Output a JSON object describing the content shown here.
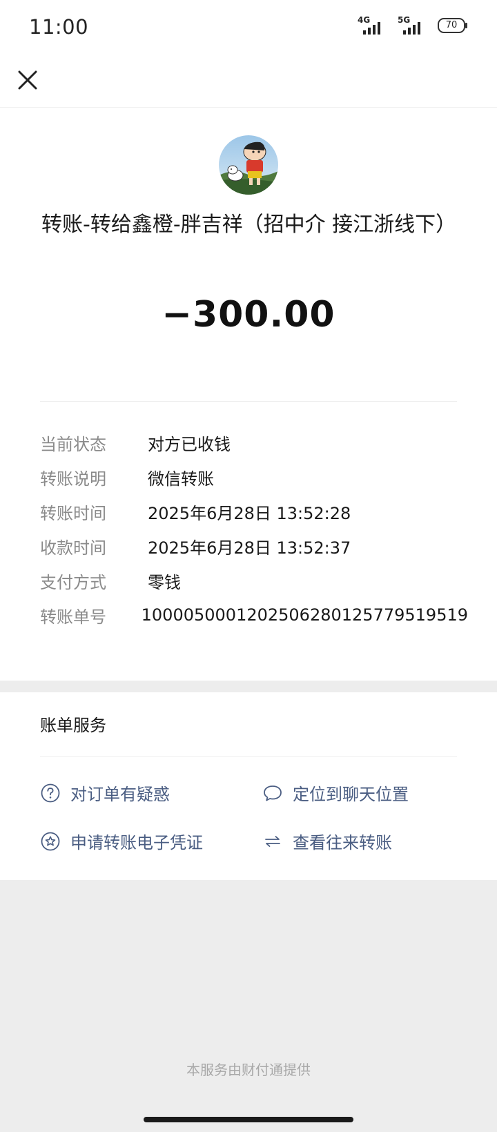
{
  "status_bar": {
    "time": "11:00",
    "network1": "4G",
    "network2": "5G",
    "battery": "70"
  },
  "icons": {
    "close": "close-icon",
    "question": "question-circle-icon",
    "chat": "chat-bubble-icon",
    "star": "star-circle-icon",
    "transfer": "transfer-arrows-icon"
  },
  "header": {
    "title": "转账-转给鑫橙-胖吉祥（招中介 接江浙线下）",
    "amount": "−300.00"
  },
  "details": [
    {
      "label": "当前状态",
      "value": "对方已收钱"
    },
    {
      "label": "转账说明",
      "value": "微信转账"
    },
    {
      "label": "转账时间",
      "value": "2025年6月28日 13:52:28"
    },
    {
      "label": "收款时间",
      "value": "2025年6月28日 13:52:37"
    },
    {
      "label": "支付方式",
      "value": "零钱"
    },
    {
      "label": "转账单号",
      "value": "1000050001202506280125779519519"
    }
  ],
  "services": {
    "title": "账单服务",
    "items": [
      {
        "label": "对订单有疑惑",
        "icon": "question-circle-icon"
      },
      {
        "label": "定位到聊天位置",
        "icon": "chat-bubble-icon"
      },
      {
        "label": "申请转账电子凭证",
        "icon": "star-circle-icon"
      },
      {
        "label": "查看往来转账",
        "icon": "transfer-arrows-icon"
      }
    ]
  },
  "footer": {
    "text": "本服务由财付通提供"
  },
  "colors": {
    "link": "#4a5d82",
    "label_gray": "#8a8a8a",
    "page_bg": "#ededed"
  }
}
